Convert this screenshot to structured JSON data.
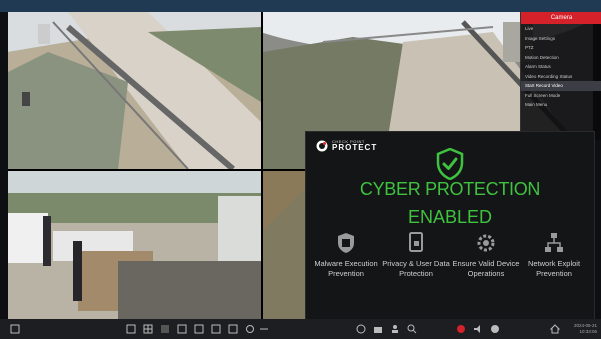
{
  "context_menu": {
    "header": "Camera",
    "items": [
      {
        "label": "Live"
      },
      {
        "label": "Image Settings"
      },
      {
        "label": "PTZ"
      },
      {
        "label": "Motion Detection"
      },
      {
        "label": "Alarm Status"
      },
      {
        "label": "Video Recording Status"
      },
      {
        "label": "Start Record Video",
        "active": true
      },
      {
        "label": "Full Screen Mode"
      },
      {
        "label": "Main Menu"
      }
    ]
  },
  "overlay": {
    "brand_small": "CHECK POINT",
    "brand_big": "PROTECT",
    "title": "CYBER PROTECTION",
    "subtitle": "ENABLED",
    "accent_color": "#3fc23f",
    "features": [
      {
        "icon": "malware-shield-icon",
        "label": "Malware Execution Prevention"
      },
      {
        "icon": "privacy-document-icon",
        "label": "Privacy & User Data Protection"
      },
      {
        "icon": "device-settings-icon",
        "label": "Ensure Valid Device Operations"
      },
      {
        "icon": "network-icon",
        "label": "Network Exploit Prevention"
      }
    ]
  },
  "bottom_bar": {
    "clock_date": "2024-05-21",
    "clock_time": "10:33:06"
  }
}
